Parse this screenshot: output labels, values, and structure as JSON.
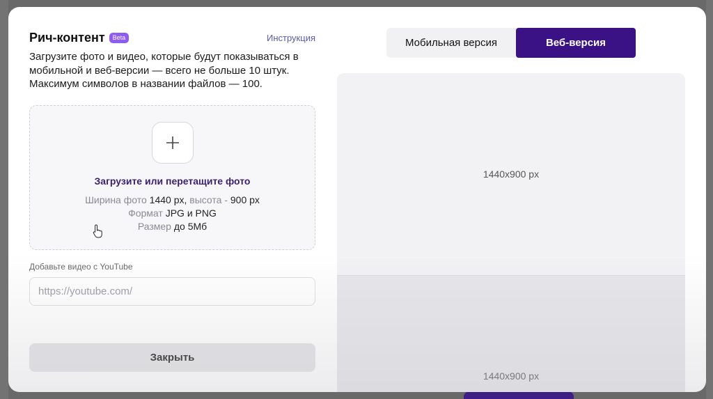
{
  "modal": {
    "title": "Рич-контент",
    "beta_badge": "Beta",
    "instruction_link": "Инструкция",
    "description": "Загрузите фото и видео, которые будут показываться в мобильной и веб-версии — всего не больше 10 штук. Максимум символов в названии файлов — 100.",
    "dropzone": {
      "title": "Загрузите или перетащите фото",
      "width_label": "Ширина фото",
      "width_value": "1440 px,",
      "height_label": "высота -",
      "height_value": "900 px",
      "format_label": "Формат",
      "format_value": "JPG и PNG",
      "size_label": "Размер",
      "size_value": "до 5Мб",
      "icon": "plus-icon"
    },
    "youtube": {
      "label": "Добавьте видео с YouTube",
      "placeholder": "https://youtube.com/",
      "value": ""
    },
    "close_button": "Закрыть"
  },
  "preview": {
    "tabs": [
      {
        "label": "Мобильная версия",
        "active": false
      },
      {
        "label": "Веб-версия",
        "active": true
      }
    ],
    "blocks": [
      {
        "label": "1440x900 px"
      },
      {
        "label": "1440x900 px"
      }
    ]
  },
  "colors": {
    "accent": "#3a1285",
    "beta": "#8f5cf0",
    "link": "#5a5aa8",
    "upload_title": "#3b1f6e"
  }
}
